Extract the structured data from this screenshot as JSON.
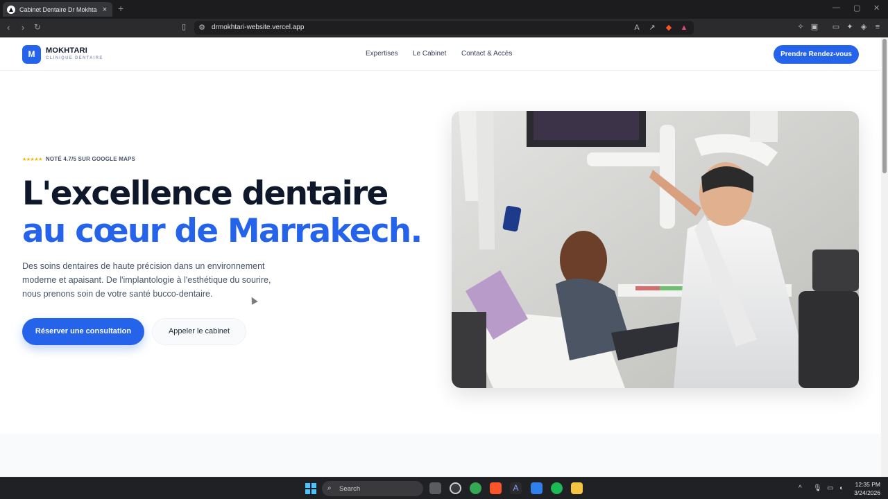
{
  "browser": {
    "tab_title": "Cabinet Dentaire Dr Mokhtari N",
    "new_tab": "+",
    "close_tab": "×",
    "url": "drmokhtari-website.vercel.app",
    "window_controls": {
      "minimize": "—",
      "maximize": "▢",
      "close": "✕"
    }
  },
  "header": {
    "logo_initial": "M",
    "logo_name": "MOKHTARI",
    "logo_subtitle": "CLINIQUE DENTAIRE",
    "nav": [
      {
        "label": "Expertises"
      },
      {
        "label": "Le Cabinet"
      },
      {
        "label": "Contact & Accès"
      }
    ],
    "cta": "Prendre Rendez-vous"
  },
  "hero": {
    "stars": "★★★★★",
    "rating": "NOTÉ 4.7/5 SUR GOOGLE MAPS",
    "headline_line1": "L'excellence dentaire",
    "headline_line2": "au cœur de Marrakech.",
    "description_lines": [
      "Des soins dentaires de haute précision dans un environnement",
      "moderne et apaisant. De l'implantologie à l'esthétique du sourire,",
      "nous prenons soin de votre santé bucco-dentaire."
    ],
    "primary_button": "Réserver une consultation",
    "secondary_button": "Appeler le cabinet"
  },
  "taskbar": {
    "search_placeholder": "Search",
    "time": "12:35 PM",
    "date": "3/24/2026"
  },
  "colors": {
    "accent": "#2563eb",
    "heading": "#0f172a",
    "body_text": "#475569",
    "star": "#f5b301"
  },
  "icons": [
    "back-icon",
    "forward-icon",
    "reload-icon",
    "bookmark-icon",
    "site-info-icon",
    "translate-icon",
    "share-icon",
    "brave-shield-icon",
    "extensions-icon",
    "search-icon",
    "windows-start-icon"
  ]
}
